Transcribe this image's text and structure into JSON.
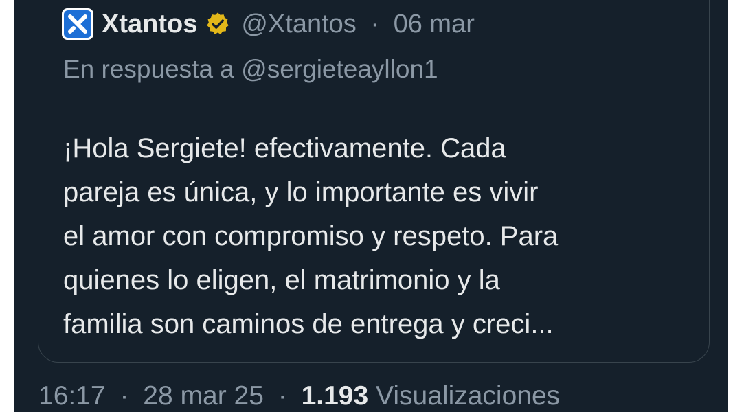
{
  "quoted_tweet": {
    "author": {
      "display_name": "Xtantos",
      "handle": "@Xtantos",
      "verified": true,
      "avatar_icon": "xtantos-logo-icon",
      "verified_icon": "verified-badge-icon"
    },
    "separator": "·",
    "date": "06 mar",
    "reply_to": "En respuesta a @sergieteayllon1",
    "text_lines": [
      "¡Hola Sergiete! efectivamente. Cada",
      "pareja es única, y lo importante es vivir",
      "el amor con compromiso y respeto. Para",
      "quienes lo eligen, el matrimonio y la",
      "familia son caminos de entrega y creci..."
    ]
  },
  "footer": {
    "time": "16:17",
    "separator": "·",
    "date": "28 mar 25",
    "views_count": "1.193",
    "views_label": "Visualizaciones"
  },
  "colors": {
    "background": "#15202b",
    "primary_text": "#e7e9ea",
    "secondary_text": "#8b98a5",
    "border": "#38444d",
    "verified_gold": "#e2b719",
    "logo_blue": "#1d6fd6"
  }
}
